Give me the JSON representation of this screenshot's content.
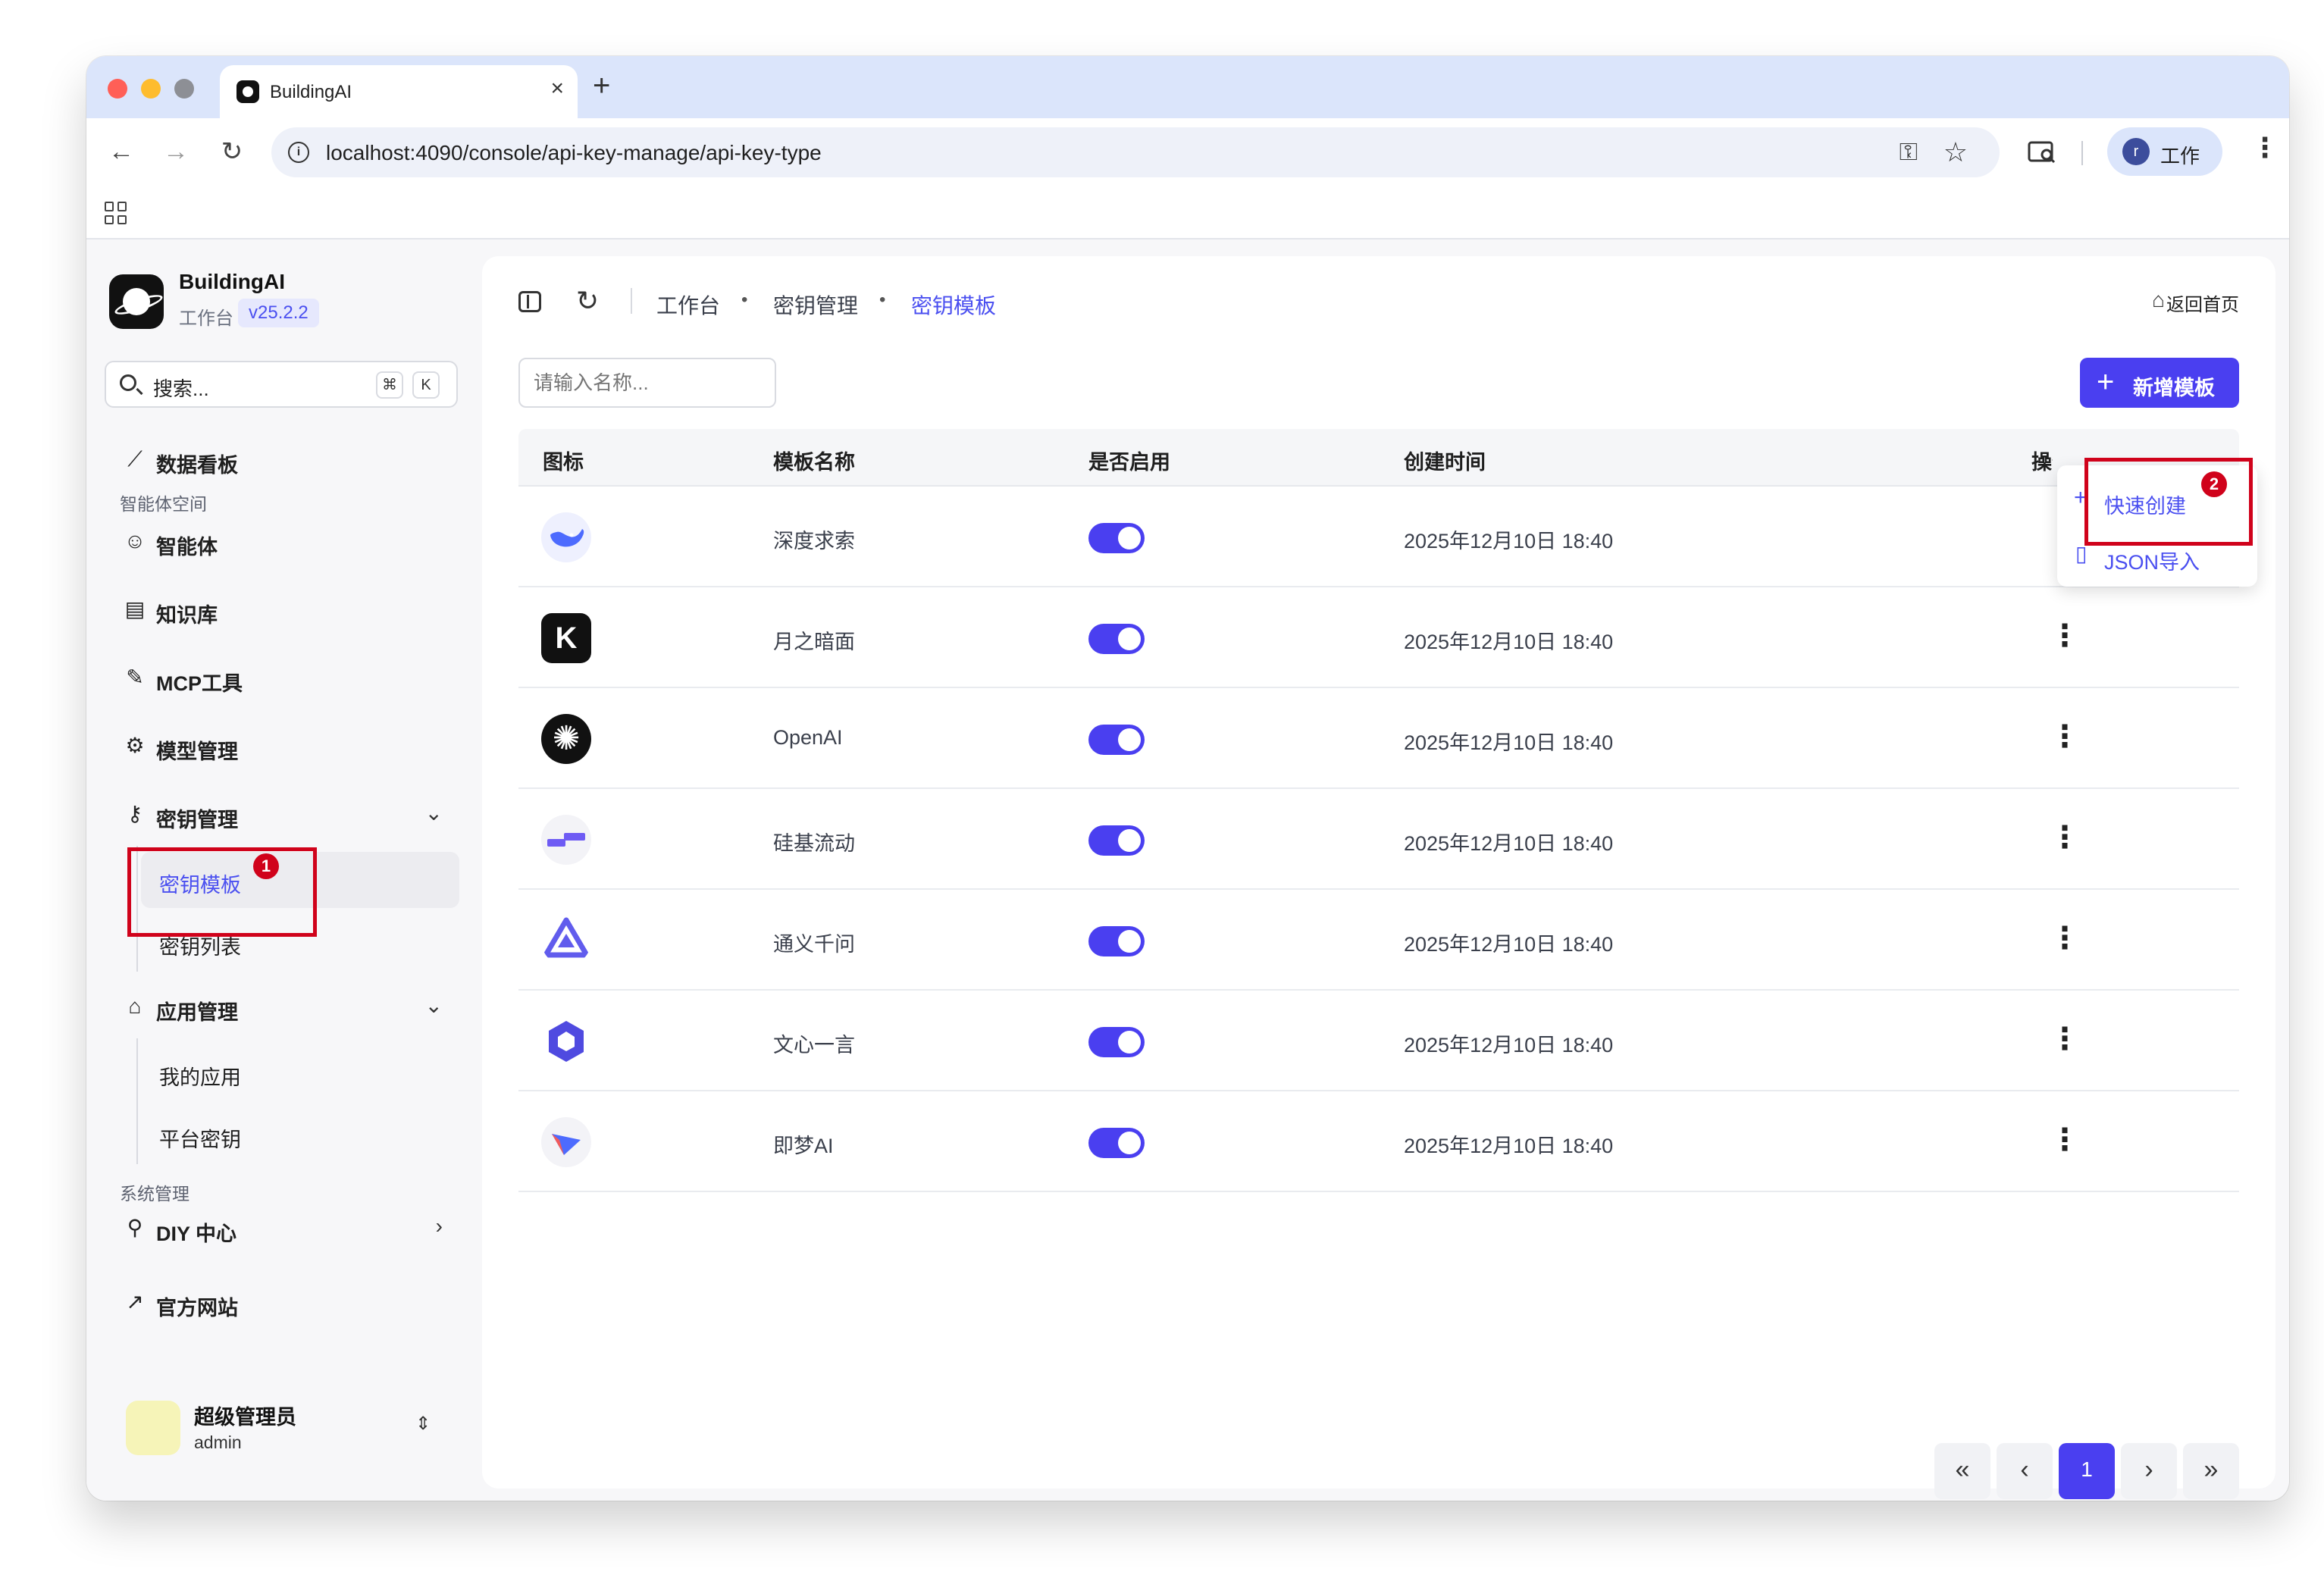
{
  "browser": {
    "tab_title": "BuildingAI",
    "url": "localhost:4090/console/api-key-manage/api-key-type",
    "profile_initial": "r",
    "profile_label": "工作"
  },
  "sidebar": {
    "brand_name": "BuildingAI",
    "brand_sub": "工作台",
    "version": "v25.2.2",
    "search_placeholder": "搜索...",
    "search_kbd_cmd": "⌘",
    "search_kbd_k": "K",
    "items": [
      {
        "label": "数据看板",
        "icon": "chart-line-icon"
      },
      {
        "label": "智能体",
        "icon": "robot-icon"
      },
      {
        "label": "知识库",
        "icon": "book-icon"
      },
      {
        "label": "MCP工具",
        "icon": "wrench-icon"
      },
      {
        "label": "模型管理",
        "icon": "model-icon"
      },
      {
        "label": "密钥管理",
        "icon": "key-icon"
      },
      {
        "label": "应用管理",
        "icon": "store-icon"
      },
      {
        "label": "DIY 中心",
        "icon": "paint-roller-icon"
      },
      {
        "label": "官方网站",
        "icon": "external-link-icon"
      }
    ],
    "section_agent": "智能体空间",
    "section_system": "系统管理",
    "key_sub": [
      "密钥模板",
      "密钥列表"
    ],
    "app_sub": [
      "我的应用",
      "平台密钥"
    ],
    "user_name": "超级管理员",
    "user_role": "admin"
  },
  "main": {
    "breadcrumb": [
      "工作台",
      "密钥管理",
      "密钥模板"
    ],
    "home_link": "返回首页",
    "name_input_placeholder": "请输入名称...",
    "add_button": "新增模板",
    "columns": [
      "图标",
      "模板名称",
      "是否启用",
      "创建时间",
      "操作"
    ],
    "rows": [
      {
        "name": "深度求索",
        "enabled": true,
        "created": "2025年12月10日 18:40",
        "icon": "deepseek-icon"
      },
      {
        "name": "月之暗面",
        "enabled": true,
        "created": "2025年12月10日 18:40",
        "icon": "kimi-icon"
      },
      {
        "name": "OpenAI",
        "enabled": true,
        "created": "2025年12月10日 18:40",
        "icon": "openai-icon"
      },
      {
        "name": "硅基流动",
        "enabled": true,
        "created": "2025年12月10日 18:40",
        "icon": "siliconflow-icon"
      },
      {
        "name": "通义千问",
        "enabled": true,
        "created": "2025年12月10日 18:40",
        "icon": "qwen-icon"
      },
      {
        "name": "文心一言",
        "enabled": true,
        "created": "2025年12月10日 18:40",
        "icon": "wenxin-icon"
      },
      {
        "name": "即梦AI",
        "enabled": true,
        "created": "2025年12月10日 18:40",
        "icon": "jimeng-icon"
      }
    ],
    "dropdown": [
      "快速创建",
      "JSON导入"
    ],
    "pagination": {
      "current": "1"
    }
  },
  "annotations": {
    "badge1": "1",
    "badge2": "2",
    "color": "#d0021b"
  },
  "colors": {
    "accent": "#4a3ff0"
  }
}
